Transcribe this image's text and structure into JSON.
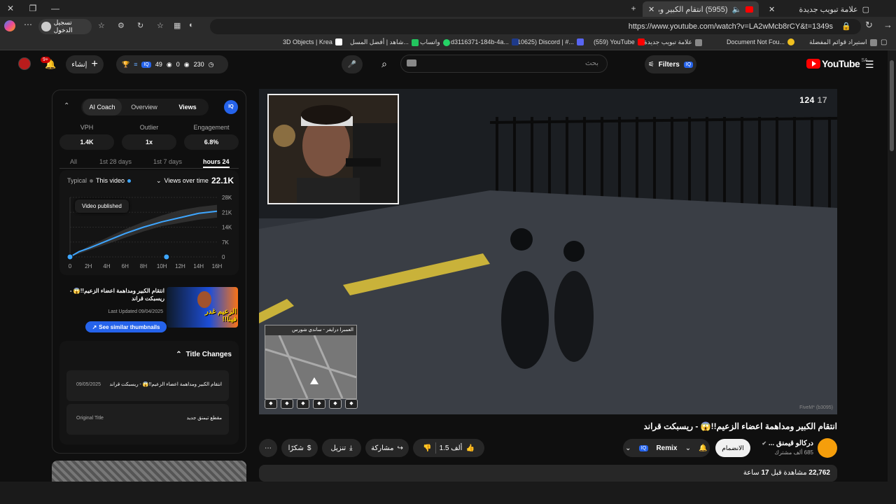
{
  "browser": {
    "tabs": [
      {
        "title": "علامة تبويب جديدة",
        "active": false
      },
      {
        "title": "(5955) انتقام الكبير ومداهمة",
        "active": true
      }
    ],
    "url": "https://www.youtube.com/watch?v=LA2wMcb8rCY&t=1349s",
    "signin_label": "تسجيل الدخول",
    "bookmarks": [
      {
        "label": "استيراد قوائم المفضلة",
        "color": "#888"
      },
      {
        "label": "Document Not Fou...",
        "color": "#f0c020"
      },
      {
        "label": "علامة تبويب جديدة",
        "color": "#888"
      },
      {
        "label": "(559) YouTube",
        "color": "#ff0000"
      },
      {
        "label": "(10625) Discord | #...",
        "color": "#5865f2"
      },
      {
        "label": "d3116371-184b-4a...",
        "color": "#1e3a8a"
      },
      {
        "label": "واتساب",
        "color": "#25d366"
      },
      {
        "label": "شاهد | أفضل المسل...",
        "color": "#22c55e"
      },
      {
        "label": "3D Objects | Krea",
        "color": "#fff"
      }
    ]
  },
  "yt": {
    "logo": "YouTube",
    "region": "SA",
    "search_placeholder": "بحث",
    "filters_label": "Filters",
    "create_label": "إنشاء",
    "notif_count": "9+",
    "stats_a": "49",
    "stats_b": "0",
    "stats_c": "230",
    "iq_badge": "IQ"
  },
  "panel": {
    "tabs": [
      "AI Coach",
      "Overview",
      "Views"
    ],
    "active_tab": "Views",
    "metrics": [
      {
        "label": "VPH",
        "value": "1.4K"
      },
      {
        "label": "Outlier",
        "value": "1x"
      },
      {
        "label": "Engagement",
        "value": "6.8%"
      }
    ],
    "ranges": [
      "All",
      "1st 28 days",
      "1st 7 days",
      "hours 24"
    ],
    "active_range": "hours 24",
    "legend_typical": "Typical",
    "legend_this": "This video",
    "views_over_time": "Views over time",
    "total": "22.1K",
    "tooltip": "Video published",
    "thumb_title": "انتقام الكبير ومداهمة اعضاء الزعيم!!😱 - ريسبكت قراند",
    "last_updated": "Last Updated 09/04/2025",
    "similar_btn": "See similar thumbnails",
    "thumb_text": "الزعيم غدر فينا!!",
    "title_changes_label": "Title Changes",
    "changes": [
      {
        "date": "09/05/2025",
        "title": "انتقام الكبير ومداهمة اعضاء الزعيم!!😱 - ريسبكت قراند"
      },
      {
        "date": "Original Title",
        "title": "مقطع تيمنق جديد"
      }
    ]
  },
  "chart_data": {
    "type": "line",
    "x_ticks": [
      "0",
      "2H",
      "4H",
      "6H",
      "8H",
      "10H",
      "12H",
      "14H",
      "16H"
    ],
    "y_ticks": [
      "28K",
      "21K",
      "14K",
      "7K",
      "0"
    ],
    "ylim": [
      0,
      28000
    ],
    "xlim": [
      0,
      16
    ],
    "series": [
      {
        "name": "This video",
        "x": [
          0,
          1,
          2,
          4,
          6,
          8,
          10,
          12,
          14,
          16
        ],
        "y": [
          0,
          2500,
          4000,
          7500,
          11000,
          14000,
          16500,
          18500,
          20500,
          21500
        ],
        "color": "#3ea6ff"
      }
    ],
    "band": {
      "x": [
        0,
        2,
        4,
        6,
        8,
        10,
        12,
        14,
        16
      ],
      "low": [
        0,
        3000,
        6000,
        9000,
        12000,
        14500,
        16000,
        17500,
        18500
      ],
      "high": [
        0,
        5000,
        9000,
        13000,
        16500,
        19500,
        22000,
        23500,
        24500
      ]
    },
    "markers_x": [
      0,
      10.5
    ]
  },
  "video": {
    "title": "انتقام الكبير ومداهمة اعضاء الزعيم!!😱 - ريسبكت قراند",
    "counter": "124",
    "counter2": "17",
    "minimap_label": "العمبرا درايفر - ساندي شورس",
    "watermark": "FiveM* (b3095)",
    "channel": "دركالو قيمنق ...",
    "subs": "685 ألف مشترك",
    "join_label": "الانضمام",
    "remix_label": "Remix",
    "likes": "1.5 ألف",
    "share_label": "مشاركة",
    "download_label": "تنزيل",
    "thanks_label": "شكرًا",
    "views": "22,762",
    "views_suffix": "مشاهدة قبل",
    "age": "17",
    "age_suffix": "ساعة"
  }
}
